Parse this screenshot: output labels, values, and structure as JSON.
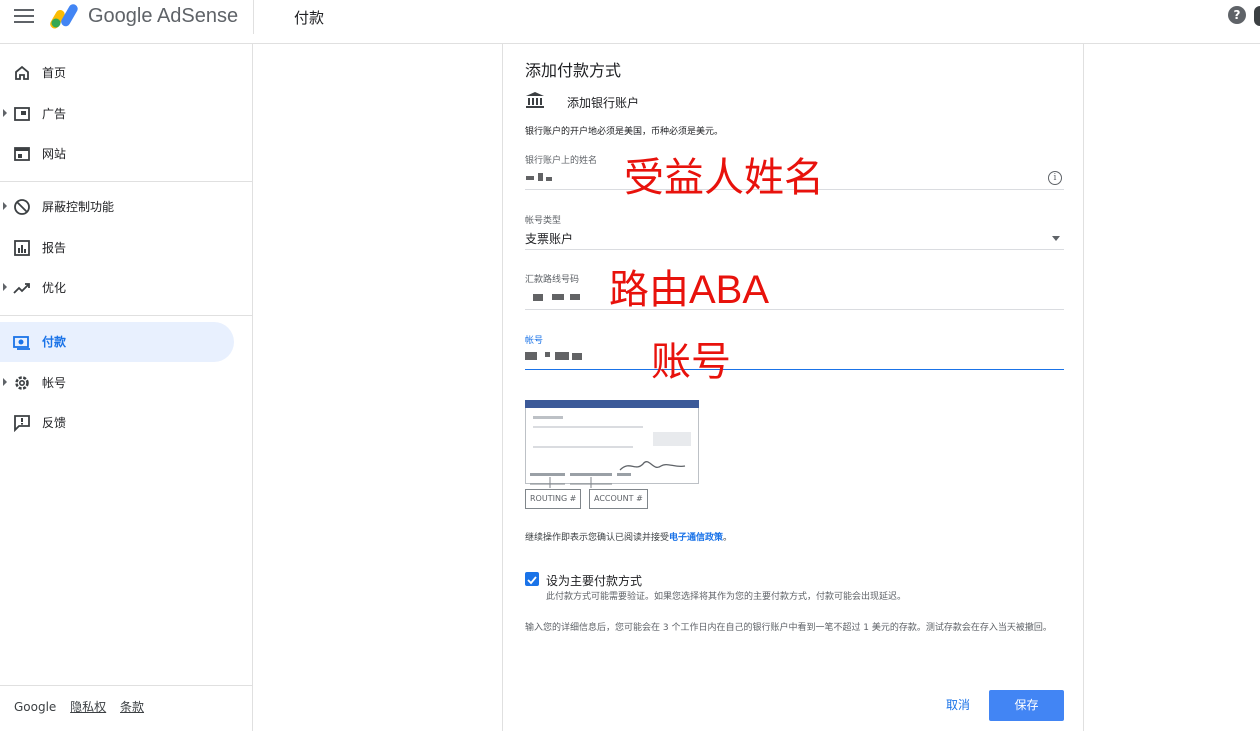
{
  "header": {
    "brand": "Google AdSense",
    "page_title": "付款",
    "help_symbol": "?"
  },
  "sidebar": {
    "items": [
      {
        "label": "首页",
        "icon": "home-icon"
      },
      {
        "label": "广告",
        "icon": "ads-icon"
      },
      {
        "label": "网站",
        "icon": "sites-icon"
      },
      {
        "label": "屏蔽控制功能",
        "icon": "block-icon"
      },
      {
        "label": "报告",
        "icon": "reports-icon"
      },
      {
        "label": "优化",
        "icon": "optimization-icon"
      },
      {
        "label": "付款",
        "icon": "payments-icon"
      },
      {
        "label": "帐号",
        "icon": "gear-icon"
      },
      {
        "label": "反馈",
        "icon": "feedback-icon"
      }
    ],
    "footer": {
      "brand": "Google",
      "privacy": "隐私权",
      "terms": "条款"
    }
  },
  "form": {
    "title": "添加付款方式",
    "method": "添加银行账户",
    "notice": "银行账户的开户地必须是美国，币种必须是美元。",
    "name_field": {
      "label": "银行账户上的姓名"
    },
    "type_field": {
      "label": "帐号类型",
      "value": "支票账户"
    },
    "routing_field": {
      "label": "汇款路线号码"
    },
    "account_field": {
      "label": "帐号"
    },
    "check_labels": {
      "routing": "ROUTING #",
      "account": "ACCOUNT #"
    },
    "agree_text": "继续操作即表示您确认已阅读并接受",
    "agree_link": "电子通信政策",
    "agree_end": "。",
    "primary_checkbox": {
      "label": "设为主要付款方式",
      "sublabel": "此付款方式可能需要验证。如果您选择将其作为您的主要付款方式，付款可能会出现延迟。",
      "checked": true
    },
    "deposit_note": "输入您的详细信息后，您可能会在 3 个工作日内在自己的银行账户中看到一笔不超过 1 美元的存款。测试存款会在存入当天被撤回。",
    "cancel": "取消",
    "save": "保存"
  },
  "annotations": {
    "name": "受益人姓名",
    "routing": "路由ABA",
    "account": "账号"
  },
  "colors": {
    "accent": "#1a73e8",
    "annotation": "#e8120c",
    "save_button": "#4285f4"
  }
}
